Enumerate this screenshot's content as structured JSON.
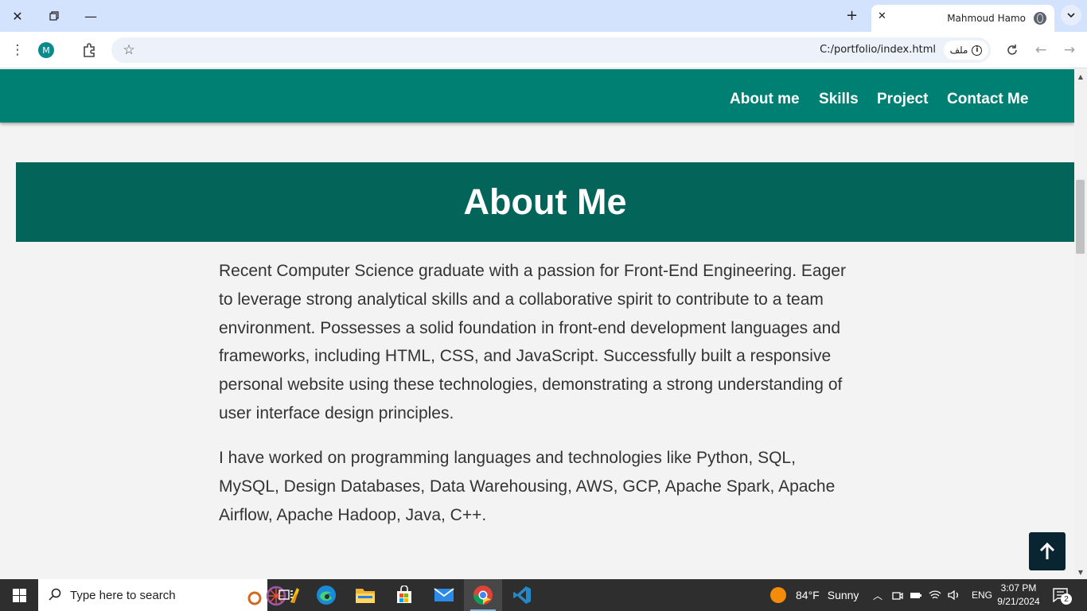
{
  "browser": {
    "tab_title": "Mahmoud Hamo",
    "url": "C:/portfolio/index.html",
    "file_chip_label": "ملف",
    "profile_initial": "M"
  },
  "site": {
    "nav_links": [
      "About me",
      "Skills",
      "Project",
      "Contact Me"
    ],
    "section_title": "About Me",
    "paragraph_1": "Recent Computer Science graduate with a passion for Front-End Engineering. Eager to leverage strong analytical skills and a collaborative spirit to contribute to a team environment. Possesses a solid foundation in front-end development languages and frameworks, including HTML, CSS, and JavaScript. Successfully built a responsive personal website using these technologies, demonstrating a strong understanding of user interface design principles.",
    "paragraph_2": "I have worked on programming languages and technologies like Python, SQL, MySQL, Design Databases, Data Warehousing, AWS, GCP, Apache Spark, Apache Airflow, Apache Hadoop, Java, C++."
  },
  "taskbar": {
    "search_placeholder": "Type here to search",
    "weather_temp": "84°F",
    "weather_text": "Sunny",
    "language": "ENG",
    "time": "3:07 PM",
    "date": "9/21/2024",
    "notification_count": "2"
  },
  "colors": {
    "nav_bg": "#008073",
    "section_header_bg": "#03645a",
    "back_to_top_bg": "#0a2532",
    "tabbar_bg": "#d3e3fd"
  }
}
